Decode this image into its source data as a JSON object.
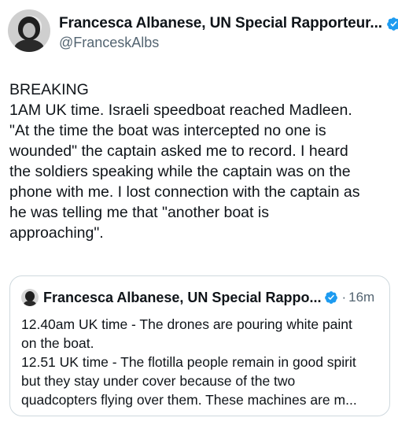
{
  "author": {
    "display_name": "Francesca Albanese, UN Special Rapporteur...",
    "handle": "@FranceskAlbs"
  },
  "body_lines": [
    "BREAKING",
    "1AM UK time. Israeli speedboat reached Madleen.",
    "\"At the time the boat was intercepted no one is",
    "wounded\" the captain asked me to record. I heard",
    "the soldiers speaking while the captain was on the",
    "phone with me. I lost connection with the captain as",
    "he was telling me that \"another boat is",
    "approaching\"."
  ],
  "quote": {
    "display_name": "Francesca Albanese, UN Special Rappo...",
    "separator": "·",
    "time": "16m",
    "lines": [
      "12.40am UK time - The drones are pouring white paint",
      "on the boat.",
      "12.51 UK time - The flotilla people remain in good spirit",
      "but they stay under cover because of the two",
      "quadcopters flying over them. These machines are m..."
    ]
  },
  "colors": {
    "verified": "#1d9bf0",
    "secondary_text": "#536471",
    "border": "#cfd9de"
  },
  "icons": {
    "verified": "verified-badge-icon"
  }
}
